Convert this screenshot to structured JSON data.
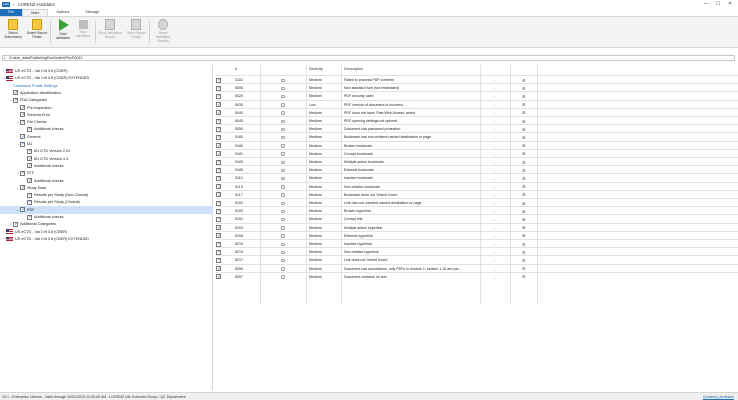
{
  "window": {
    "app_icon": "LRZ",
    "title": "LORENZ eValidator",
    "controls": [
      "—",
      "☐",
      "✕"
    ]
  },
  "menu": {
    "tabs": [
      "File",
      "Main",
      "Options",
      "Manage"
    ]
  },
  "ribbon": {
    "buttons": [
      {
        "label": "Select Submission",
        "icon": "folder-icon",
        "enabled": true
      },
      {
        "label": "Select Report Folder",
        "icon": "folder-icon",
        "enabled": true
      },
      {
        "label": "Start validation",
        "icon": "play-icon",
        "enabled": true
      },
      {
        "label": "Stop validation",
        "icon": "stop-icon",
        "enabled": false
      },
      {
        "label": "Show Validation Report",
        "icon": "report-icon",
        "enabled": false
      },
      {
        "label": "Open Report Folder",
        "icon": "folder-icon",
        "enabled": false
      },
      {
        "label": "Reset Validation Results",
        "icon": "reset-icon",
        "enabled": false
      }
    ]
  },
  "path": {
    "value": "D:\\slob_data\\PublishingPool\\index\\PHxZ\\0010"
  },
  "tree": [
    {
      "label": "US eCTD - Val Crit 3.8 (CDER)",
      "indent": 0,
      "arrow": "›",
      "flag": true,
      "checkbox": false
    },
    {
      "label": "US eCTD - Val Crit 3.8 (CDER) EXTENDED",
      "indent": 0,
      "arrow": "⌄",
      "flag": true,
      "checkbox": false
    },
    {
      "label": "Customize Profile Settings",
      "indent": 1,
      "arrow": "",
      "link": true,
      "checkbox": false
    },
    {
      "label": "Application Identification",
      "indent": 1,
      "arrow": "",
      "checkbox": true
    },
    {
      "label": "FDA Categories",
      "indent": 1,
      "arrow": "⌄",
      "checkbox": true
    },
    {
      "label": "Pre-Inspection",
      "indent": 2,
      "arrow": "",
      "checkbox": true
    },
    {
      "label": "Schema Error",
      "indent": 2,
      "arrow": "",
      "checkbox": true
    },
    {
      "label": "File Checks",
      "indent": 2,
      "arrow": "⌄",
      "checkbox": true
    },
    {
      "label": "Additional checks",
      "indent": 3,
      "arrow": "",
      "checkbox": true
    },
    {
      "label": "General",
      "indent": 2,
      "arrow": "",
      "checkbox": true
    },
    {
      "label": "M1",
      "indent": 2,
      "arrow": "⌄",
      "checkbox": true
    },
    {
      "label": "M1 DTD Version 2.01",
      "indent": 3,
      "arrow": "",
      "checkbox": true
    },
    {
      "label": "M1 DTD Version 3.3",
      "indent": 3,
      "arrow": "",
      "checkbox": true
    },
    {
      "label": "Additional checks",
      "indent": 3,
      "arrow": "",
      "checkbox": true
    },
    {
      "label": "STF",
      "indent": 2,
      "arrow": "⌄",
      "checkbox": true
    },
    {
      "label": "Additional checks",
      "indent": 3,
      "arrow": "",
      "checkbox": true
    },
    {
      "label": "Study Data",
      "indent": 2,
      "arrow": "⌄",
      "checkbox": true
    },
    {
      "label": "Results per Study (Non-Clinical)",
      "indent": 3,
      "arrow": "",
      "checkbox": true
    },
    {
      "label": "Results per Study (Clinical)",
      "indent": 3,
      "arrow": "",
      "checkbox": true
    },
    {
      "label": "PDF",
      "indent": 2,
      "arrow": "⌄",
      "checkbox": true,
      "selected": true
    },
    {
      "label": "Additional checks",
      "indent": 3,
      "arrow": "",
      "checkbox": true
    },
    {
      "label": "Additional Categories",
      "indent": 1,
      "arrow": "›",
      "checkbox": true
    },
    {
      "label": "US eCTD - Val Crit 3.8 (CBER)",
      "indent": 0,
      "arrow": "›",
      "flag": true,
      "checkbox": false
    },
    {
      "label": "US eCTD - Val Crit 3.8 (CBER) EXTENDED",
      "indent": 0,
      "arrow": "›",
      "flag": true,
      "checkbox": false
    }
  ],
  "grid": {
    "headers": {
      "num": "#",
      "severity": "Severity",
      "description": "Description"
    },
    "rows": [
      {
        "num": "3102",
        "severity": "Medium",
        "description": "Failed to process PDF contents"
      },
      {
        "num": "5005",
        "severity": "Medium",
        "description": "Non standard font (not embedded)"
      },
      {
        "num": "5020",
        "severity": "Medium",
        "description": "PDF security used"
      },
      {
        "num": "5035",
        "severity": "Low",
        "description": "PDF version of document is incorrect"
      },
      {
        "num": "5040",
        "severity": "Medium",
        "description": "PDF does not have 'Fast Web Access' active"
      },
      {
        "num": "5045",
        "severity": "Medium",
        "description": "PDF opening settings not optimal"
      },
      {
        "num": "5050",
        "severity": "Medium",
        "description": "Document has password protection"
      },
      {
        "num": "5160",
        "severity": "Medium",
        "description": "Bookmark has non-existent named destination or page"
      },
      {
        "num": "5180",
        "severity": "Medium",
        "description": "Broken bookmark"
      },
      {
        "num": "5181",
        "severity": "Medium",
        "description": "Corrupt bookmark"
      },
      {
        "num": "5183",
        "severity": "Medium",
        "description": "Multiple action bookmark"
      },
      {
        "num": "5185",
        "severity": "Medium",
        "description": "External bookmark"
      },
      {
        "num": "5110",
        "severity": "Medium",
        "description": "Inactive bookmark"
      },
      {
        "num": "5115",
        "severity": "Medium",
        "description": "Non-relative bookmark"
      },
      {
        "num": "5117",
        "severity": "Medium",
        "description": "Bookmark does not 'Inherit Zoom'"
      },
      {
        "num": "5202",
        "severity": "Medium",
        "description": "Link has non-existent named destination or page"
      },
      {
        "num": "5200",
        "severity": "Medium",
        "description": "Broken hyperlink"
      },
      {
        "num": "5201",
        "severity": "Medium",
        "description": "Corrupt link"
      },
      {
        "num": "5203",
        "severity": "Medium",
        "description": "Multiple action hyperlink"
      },
      {
        "num": "5205",
        "severity": "Medium",
        "description": "External hyperlink"
      },
      {
        "num": "5210",
        "severity": "Medium",
        "description": "Inactive hyperlink"
      },
      {
        "num": "5215",
        "severity": "Medium",
        "description": "Non-relative hyperlink"
      },
      {
        "num": "5217",
        "severity": "Medium",
        "description": "Link does not 'Inherit Zoom'"
      },
      {
        "num": "5055",
        "severity": "Medium",
        "description": "Document has annotations, only PDFs in module 1, section 1.15 are per..."
      },
      {
        "num": "5057",
        "severity": "Medium",
        "description": "Document contains no text"
      }
    ]
  },
  "status": {
    "license": "19.1 - Enterprise License - Valid through 12/31/2019 12:00:00 AM - LORENZ Life Sciences Group / QC Department",
    "update": "Update(s) Available"
  },
  "colors": {
    "accent": "#1e6fb8",
    "selection": "#cde2f6",
    "ribbon_bg": "#f3f3f3"
  }
}
